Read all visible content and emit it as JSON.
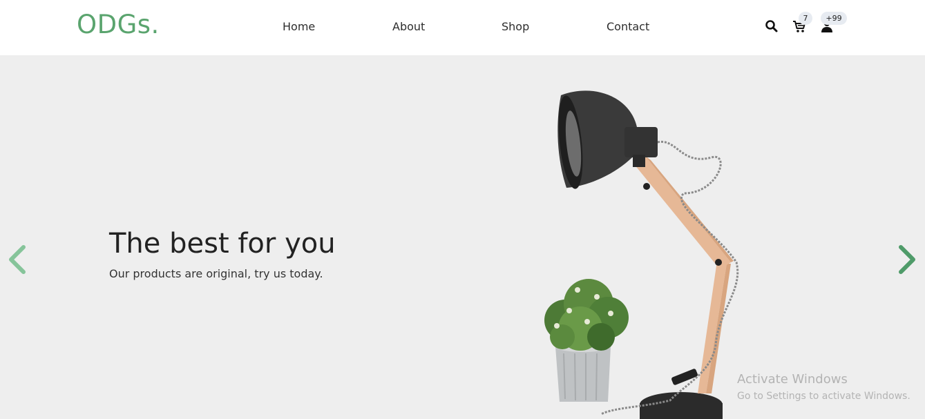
{
  "header": {
    "logo": "ODGs.",
    "nav": {
      "home": "Home",
      "about": "About",
      "shop": "Shop",
      "contact": "Contact"
    },
    "icons": {
      "search": "search-icon",
      "cart": "cart-icon",
      "user": "user-icon"
    },
    "cart_count": "7",
    "user_count": "+99"
  },
  "hero": {
    "title": "The best for you",
    "subtitle": "Our products are original, try us today.",
    "prev_icon": "chevron-left-icon",
    "next_icon": "chevron-right-icon",
    "image": "desk-lamp-and-potted-plant"
  },
  "watermark": {
    "title": "Activate Windows",
    "subtitle": "Go to Settings to activate Windows."
  },
  "colors": {
    "brand": "#5aa46e",
    "arrow_prev": "#86c49a",
    "arrow_next": "#4f9b69",
    "hero_bg": "#eeeeee",
    "badge_bg": "#e7ebf1"
  }
}
